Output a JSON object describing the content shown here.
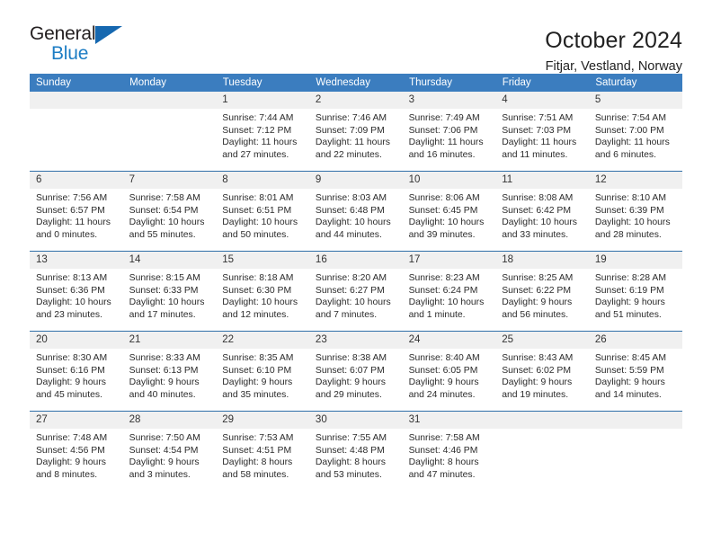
{
  "brand": {
    "name_top": "General",
    "name_bottom": "Blue",
    "triangle_color": "#1668b0",
    "blue_color": "#1d7dc4"
  },
  "header": {
    "title": "October 2024",
    "subtitle": "Fitjar, Vestland, Norway"
  },
  "theme": {
    "header_blue": "#3b7dbf",
    "row_rule_blue": "#2f6fa8",
    "daynum_bg": "#f0f0f0"
  },
  "calendar": {
    "weekday_headers": [
      "Sunday",
      "Monday",
      "Tuesday",
      "Wednesday",
      "Thursday",
      "Friday",
      "Saturday"
    ],
    "weeks": [
      [
        {
          "day": "",
          "sunrise": "",
          "sunset": "",
          "daylight1": "",
          "daylight2": "",
          "empty": true
        },
        {
          "day": "",
          "sunrise": "",
          "sunset": "",
          "daylight1": "",
          "daylight2": "",
          "empty": true
        },
        {
          "day": "1",
          "sunrise": "Sunrise: 7:44 AM",
          "sunset": "Sunset: 7:12 PM",
          "daylight1": "Daylight: 11 hours",
          "daylight2": "and 27 minutes."
        },
        {
          "day": "2",
          "sunrise": "Sunrise: 7:46 AM",
          "sunset": "Sunset: 7:09 PM",
          "daylight1": "Daylight: 11 hours",
          "daylight2": "and 22 minutes."
        },
        {
          "day": "3",
          "sunrise": "Sunrise: 7:49 AM",
          "sunset": "Sunset: 7:06 PM",
          "daylight1": "Daylight: 11 hours",
          "daylight2": "and 16 minutes."
        },
        {
          "day": "4",
          "sunrise": "Sunrise: 7:51 AM",
          "sunset": "Sunset: 7:03 PM",
          "daylight1": "Daylight: 11 hours",
          "daylight2": "and 11 minutes."
        },
        {
          "day": "5",
          "sunrise": "Sunrise: 7:54 AM",
          "sunset": "Sunset: 7:00 PM",
          "daylight1": "Daylight: 11 hours",
          "daylight2": "and 6 minutes."
        }
      ],
      [
        {
          "day": "6",
          "sunrise": "Sunrise: 7:56 AM",
          "sunset": "Sunset: 6:57 PM",
          "daylight1": "Daylight: 11 hours",
          "daylight2": "and 0 minutes."
        },
        {
          "day": "7",
          "sunrise": "Sunrise: 7:58 AM",
          "sunset": "Sunset: 6:54 PM",
          "daylight1": "Daylight: 10 hours",
          "daylight2": "and 55 minutes."
        },
        {
          "day": "8",
          "sunrise": "Sunrise: 8:01 AM",
          "sunset": "Sunset: 6:51 PM",
          "daylight1": "Daylight: 10 hours",
          "daylight2": "and 50 minutes."
        },
        {
          "day": "9",
          "sunrise": "Sunrise: 8:03 AM",
          "sunset": "Sunset: 6:48 PM",
          "daylight1": "Daylight: 10 hours",
          "daylight2": "and 44 minutes."
        },
        {
          "day": "10",
          "sunrise": "Sunrise: 8:06 AM",
          "sunset": "Sunset: 6:45 PM",
          "daylight1": "Daylight: 10 hours",
          "daylight2": "and 39 minutes."
        },
        {
          "day": "11",
          "sunrise": "Sunrise: 8:08 AM",
          "sunset": "Sunset: 6:42 PM",
          "daylight1": "Daylight: 10 hours",
          "daylight2": "and 33 minutes."
        },
        {
          "day": "12",
          "sunrise": "Sunrise: 8:10 AM",
          "sunset": "Sunset: 6:39 PM",
          "daylight1": "Daylight: 10 hours",
          "daylight2": "and 28 minutes."
        }
      ],
      [
        {
          "day": "13",
          "sunrise": "Sunrise: 8:13 AM",
          "sunset": "Sunset: 6:36 PM",
          "daylight1": "Daylight: 10 hours",
          "daylight2": "and 23 minutes."
        },
        {
          "day": "14",
          "sunrise": "Sunrise: 8:15 AM",
          "sunset": "Sunset: 6:33 PM",
          "daylight1": "Daylight: 10 hours",
          "daylight2": "and 17 minutes."
        },
        {
          "day": "15",
          "sunrise": "Sunrise: 8:18 AM",
          "sunset": "Sunset: 6:30 PM",
          "daylight1": "Daylight: 10 hours",
          "daylight2": "and 12 minutes."
        },
        {
          "day": "16",
          "sunrise": "Sunrise: 8:20 AM",
          "sunset": "Sunset: 6:27 PM",
          "daylight1": "Daylight: 10 hours",
          "daylight2": "and 7 minutes."
        },
        {
          "day": "17",
          "sunrise": "Sunrise: 8:23 AM",
          "sunset": "Sunset: 6:24 PM",
          "daylight1": "Daylight: 10 hours",
          "daylight2": "and 1 minute."
        },
        {
          "day": "18",
          "sunrise": "Sunrise: 8:25 AM",
          "sunset": "Sunset: 6:22 PM",
          "daylight1": "Daylight: 9 hours",
          "daylight2": "and 56 minutes."
        },
        {
          "day": "19",
          "sunrise": "Sunrise: 8:28 AM",
          "sunset": "Sunset: 6:19 PM",
          "daylight1": "Daylight: 9 hours",
          "daylight2": "and 51 minutes."
        }
      ],
      [
        {
          "day": "20",
          "sunrise": "Sunrise: 8:30 AM",
          "sunset": "Sunset: 6:16 PM",
          "daylight1": "Daylight: 9 hours",
          "daylight2": "and 45 minutes."
        },
        {
          "day": "21",
          "sunrise": "Sunrise: 8:33 AM",
          "sunset": "Sunset: 6:13 PM",
          "daylight1": "Daylight: 9 hours",
          "daylight2": "and 40 minutes."
        },
        {
          "day": "22",
          "sunrise": "Sunrise: 8:35 AM",
          "sunset": "Sunset: 6:10 PM",
          "daylight1": "Daylight: 9 hours",
          "daylight2": "and 35 minutes."
        },
        {
          "day": "23",
          "sunrise": "Sunrise: 8:38 AM",
          "sunset": "Sunset: 6:07 PM",
          "daylight1": "Daylight: 9 hours",
          "daylight2": "and 29 minutes."
        },
        {
          "day": "24",
          "sunrise": "Sunrise: 8:40 AM",
          "sunset": "Sunset: 6:05 PM",
          "daylight1": "Daylight: 9 hours",
          "daylight2": "and 24 minutes."
        },
        {
          "day": "25",
          "sunrise": "Sunrise: 8:43 AM",
          "sunset": "Sunset: 6:02 PM",
          "daylight1": "Daylight: 9 hours",
          "daylight2": "and 19 minutes."
        },
        {
          "day": "26",
          "sunrise": "Sunrise: 8:45 AM",
          "sunset": "Sunset: 5:59 PM",
          "daylight1": "Daylight: 9 hours",
          "daylight2": "and 14 minutes."
        }
      ],
      [
        {
          "day": "27",
          "sunrise": "Sunrise: 7:48 AM",
          "sunset": "Sunset: 4:56 PM",
          "daylight1": "Daylight: 9 hours",
          "daylight2": "and 8 minutes."
        },
        {
          "day": "28",
          "sunrise": "Sunrise: 7:50 AM",
          "sunset": "Sunset: 4:54 PM",
          "daylight1": "Daylight: 9 hours",
          "daylight2": "and 3 minutes."
        },
        {
          "day": "29",
          "sunrise": "Sunrise: 7:53 AM",
          "sunset": "Sunset: 4:51 PM",
          "daylight1": "Daylight: 8 hours",
          "daylight2": "and 58 minutes."
        },
        {
          "day": "30",
          "sunrise": "Sunrise: 7:55 AM",
          "sunset": "Sunset: 4:48 PM",
          "daylight1": "Daylight: 8 hours",
          "daylight2": "and 53 minutes."
        },
        {
          "day": "31",
          "sunrise": "Sunrise: 7:58 AM",
          "sunset": "Sunset: 4:46 PM",
          "daylight1": "Daylight: 8 hours",
          "daylight2": "and 47 minutes."
        },
        {
          "day": "",
          "sunrise": "",
          "sunset": "",
          "daylight1": "",
          "daylight2": "",
          "empty": true
        },
        {
          "day": "",
          "sunrise": "",
          "sunset": "",
          "daylight1": "",
          "daylight2": "",
          "empty": true
        }
      ]
    ]
  }
}
